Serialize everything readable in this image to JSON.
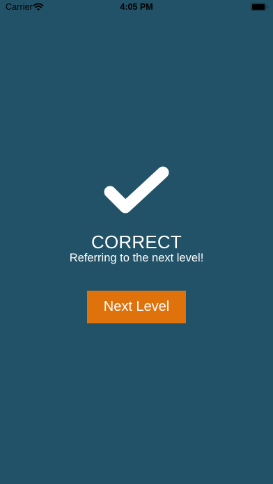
{
  "status_bar": {
    "carrier": "Carrier",
    "time": "4:05 PM",
    "icons": [
      "wifi-icon",
      "battery-icon"
    ]
  },
  "result": {
    "icon": "checkmark-icon",
    "title": "CORRECT",
    "message": "Referring to the next level!"
  },
  "actions": {
    "next_level_label": "Next Level"
  },
  "colors": {
    "background": "#215267",
    "button": "#e0720c",
    "text": "#ffffff",
    "status_text": "#000000"
  }
}
